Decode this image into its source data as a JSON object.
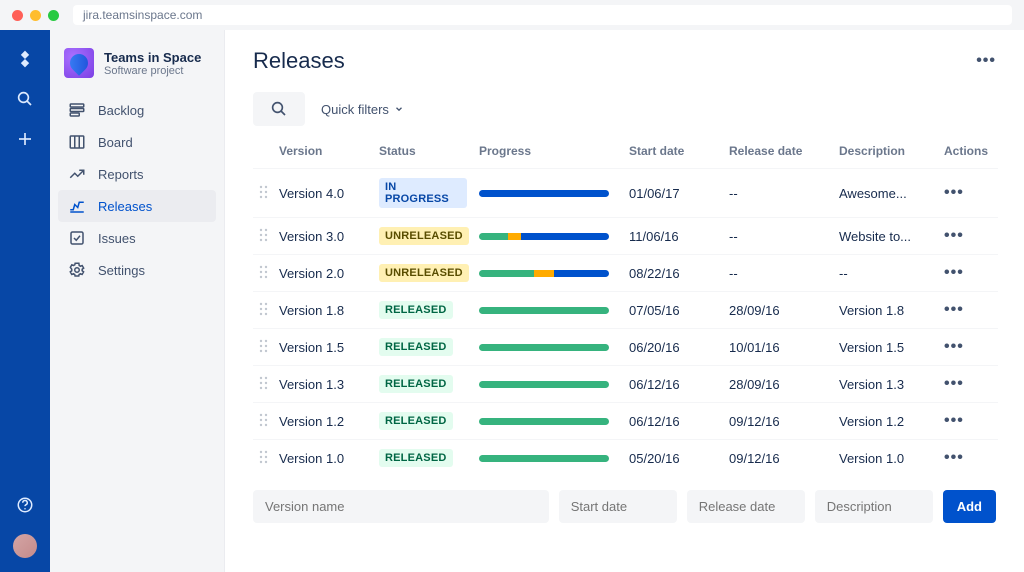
{
  "browser": {
    "url": "jira.teamsinspace.com"
  },
  "project": {
    "name": "Teams in Space",
    "type": "Software project"
  },
  "sidebar": {
    "items": [
      {
        "label": "Backlog",
        "icon": "backlog-icon"
      },
      {
        "label": "Board",
        "icon": "board-icon"
      },
      {
        "label": "Reports",
        "icon": "reports-icon"
      },
      {
        "label": "Releases",
        "icon": "releases-icon",
        "selected": true
      },
      {
        "label": "Issues",
        "icon": "issues-icon"
      },
      {
        "label": "Settings",
        "icon": "settings-icon"
      }
    ]
  },
  "page": {
    "title": "Releases"
  },
  "toolbar": {
    "quick_filters": "Quick filters"
  },
  "table": {
    "headers": {
      "version": "Version",
      "status": "Status",
      "progress": "Progress",
      "start_date": "Start date",
      "release_date": "Release date",
      "description": "Description",
      "actions": "Actions"
    },
    "rows": [
      {
        "version": "Version 4.0",
        "status": "IN PROGRESS",
        "status_class": "status-in-progress",
        "progress": [
          [
            "blue",
            100
          ]
        ],
        "start_date": "01/06/17",
        "release_date": "--",
        "description": "Awesome..."
      },
      {
        "version": "Version 3.0",
        "status": "UNRELEASED",
        "status_class": "status-unreleased",
        "progress": [
          [
            "green",
            22
          ],
          [
            "yellow",
            10
          ],
          [
            "blue",
            68
          ]
        ],
        "start_date": "11/06/16",
        "release_date": "--",
        "description": "Website to..."
      },
      {
        "version": "Version 2.0",
        "status": "UNRELEASED",
        "status_class": "status-unreleased",
        "progress": [
          [
            "green",
            42
          ],
          [
            "yellow",
            16
          ],
          [
            "blue",
            42
          ]
        ],
        "start_date": "08/22/16",
        "release_date": "--",
        "description": "--"
      },
      {
        "version": "Version 1.8",
        "status": "RELEASED",
        "status_class": "status-released",
        "progress": [
          [
            "green",
            100
          ]
        ],
        "start_date": "07/05/16",
        "release_date": "28/09/16",
        "description": "Version 1.8"
      },
      {
        "version": "Version 1.5",
        "status": "RELEASED",
        "status_class": "status-released",
        "progress": [
          [
            "green",
            100
          ]
        ],
        "start_date": "06/20/16",
        "release_date": "10/01/16",
        "description": "Version 1.5"
      },
      {
        "version": "Version 1.3",
        "status": "RELEASED",
        "status_class": "status-released",
        "progress": [
          [
            "green",
            100
          ]
        ],
        "start_date": "06/12/16",
        "release_date": "28/09/16",
        "description": "Version 1.3"
      },
      {
        "version": "Version 1.2",
        "status": "RELEASED",
        "status_class": "status-released",
        "progress": [
          [
            "green",
            100
          ]
        ],
        "start_date": "06/12/16",
        "release_date": "09/12/16",
        "description": "Version 1.2"
      },
      {
        "version": "Version 1.0",
        "status": "RELEASED",
        "status_class": "status-released",
        "progress": [
          [
            "green",
            100
          ]
        ],
        "start_date": "05/20/16",
        "release_date": "09/12/16",
        "description": "Version 1.0"
      }
    ]
  },
  "add_row": {
    "version_placeholder": "Version name",
    "start_placeholder": "Start date",
    "release_placeholder": "Release date",
    "description_placeholder": "Description",
    "add_label": "Add"
  }
}
